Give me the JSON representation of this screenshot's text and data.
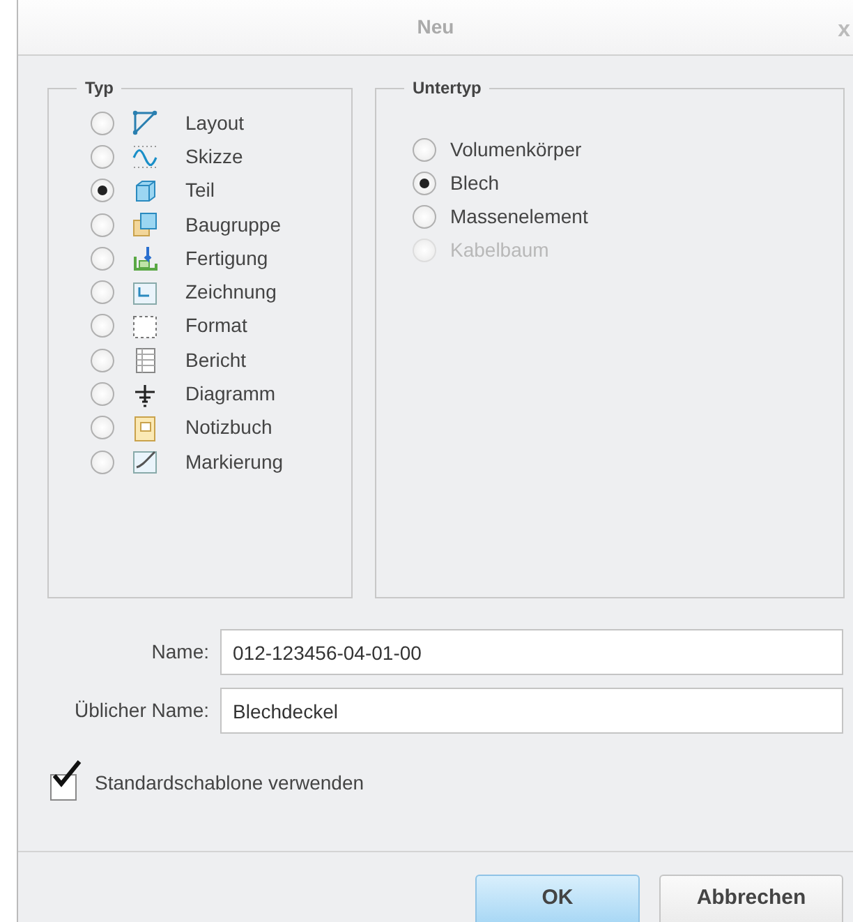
{
  "window": {
    "title": "Neu",
    "close": "x"
  },
  "type_group": {
    "title": "Typ",
    "items": [
      {
        "label": "Layout",
        "selected": false
      },
      {
        "label": "Skizze",
        "selected": false
      },
      {
        "label": "Teil",
        "selected": true
      },
      {
        "label": "Baugruppe",
        "selected": false
      },
      {
        "label": "Fertigung",
        "selected": false
      },
      {
        "label": "Zeichnung",
        "selected": false
      },
      {
        "label": "Format",
        "selected": false
      },
      {
        "label": "Bericht",
        "selected": false
      },
      {
        "label": "Diagramm",
        "selected": false
      },
      {
        "label": "Notizbuch",
        "selected": false
      },
      {
        "label": "Markierung",
        "selected": false
      }
    ]
  },
  "subtype_group": {
    "title": "Untertyp",
    "items": [
      {
        "label": "Volumenkörper",
        "selected": false,
        "disabled": false
      },
      {
        "label": "Blech",
        "selected": true,
        "disabled": false
      },
      {
        "label": "Massenelement",
        "selected": false,
        "disabled": false
      },
      {
        "label": "Kabelbaum",
        "selected": false,
        "disabled": true
      }
    ]
  },
  "fields": [
    {
      "label": "Name:",
      "value": "012-123456-04-01-00"
    },
    {
      "label": "Üblicher Name:",
      "value": "Blechdeckel"
    }
  ],
  "template_checkbox": {
    "label": "Standardschablone verwenden",
    "checked": true
  },
  "buttons": [
    {
      "label": "OK",
      "kind": "primary"
    },
    {
      "label": "Abbrechen",
      "kind": "secondary"
    }
  ]
}
